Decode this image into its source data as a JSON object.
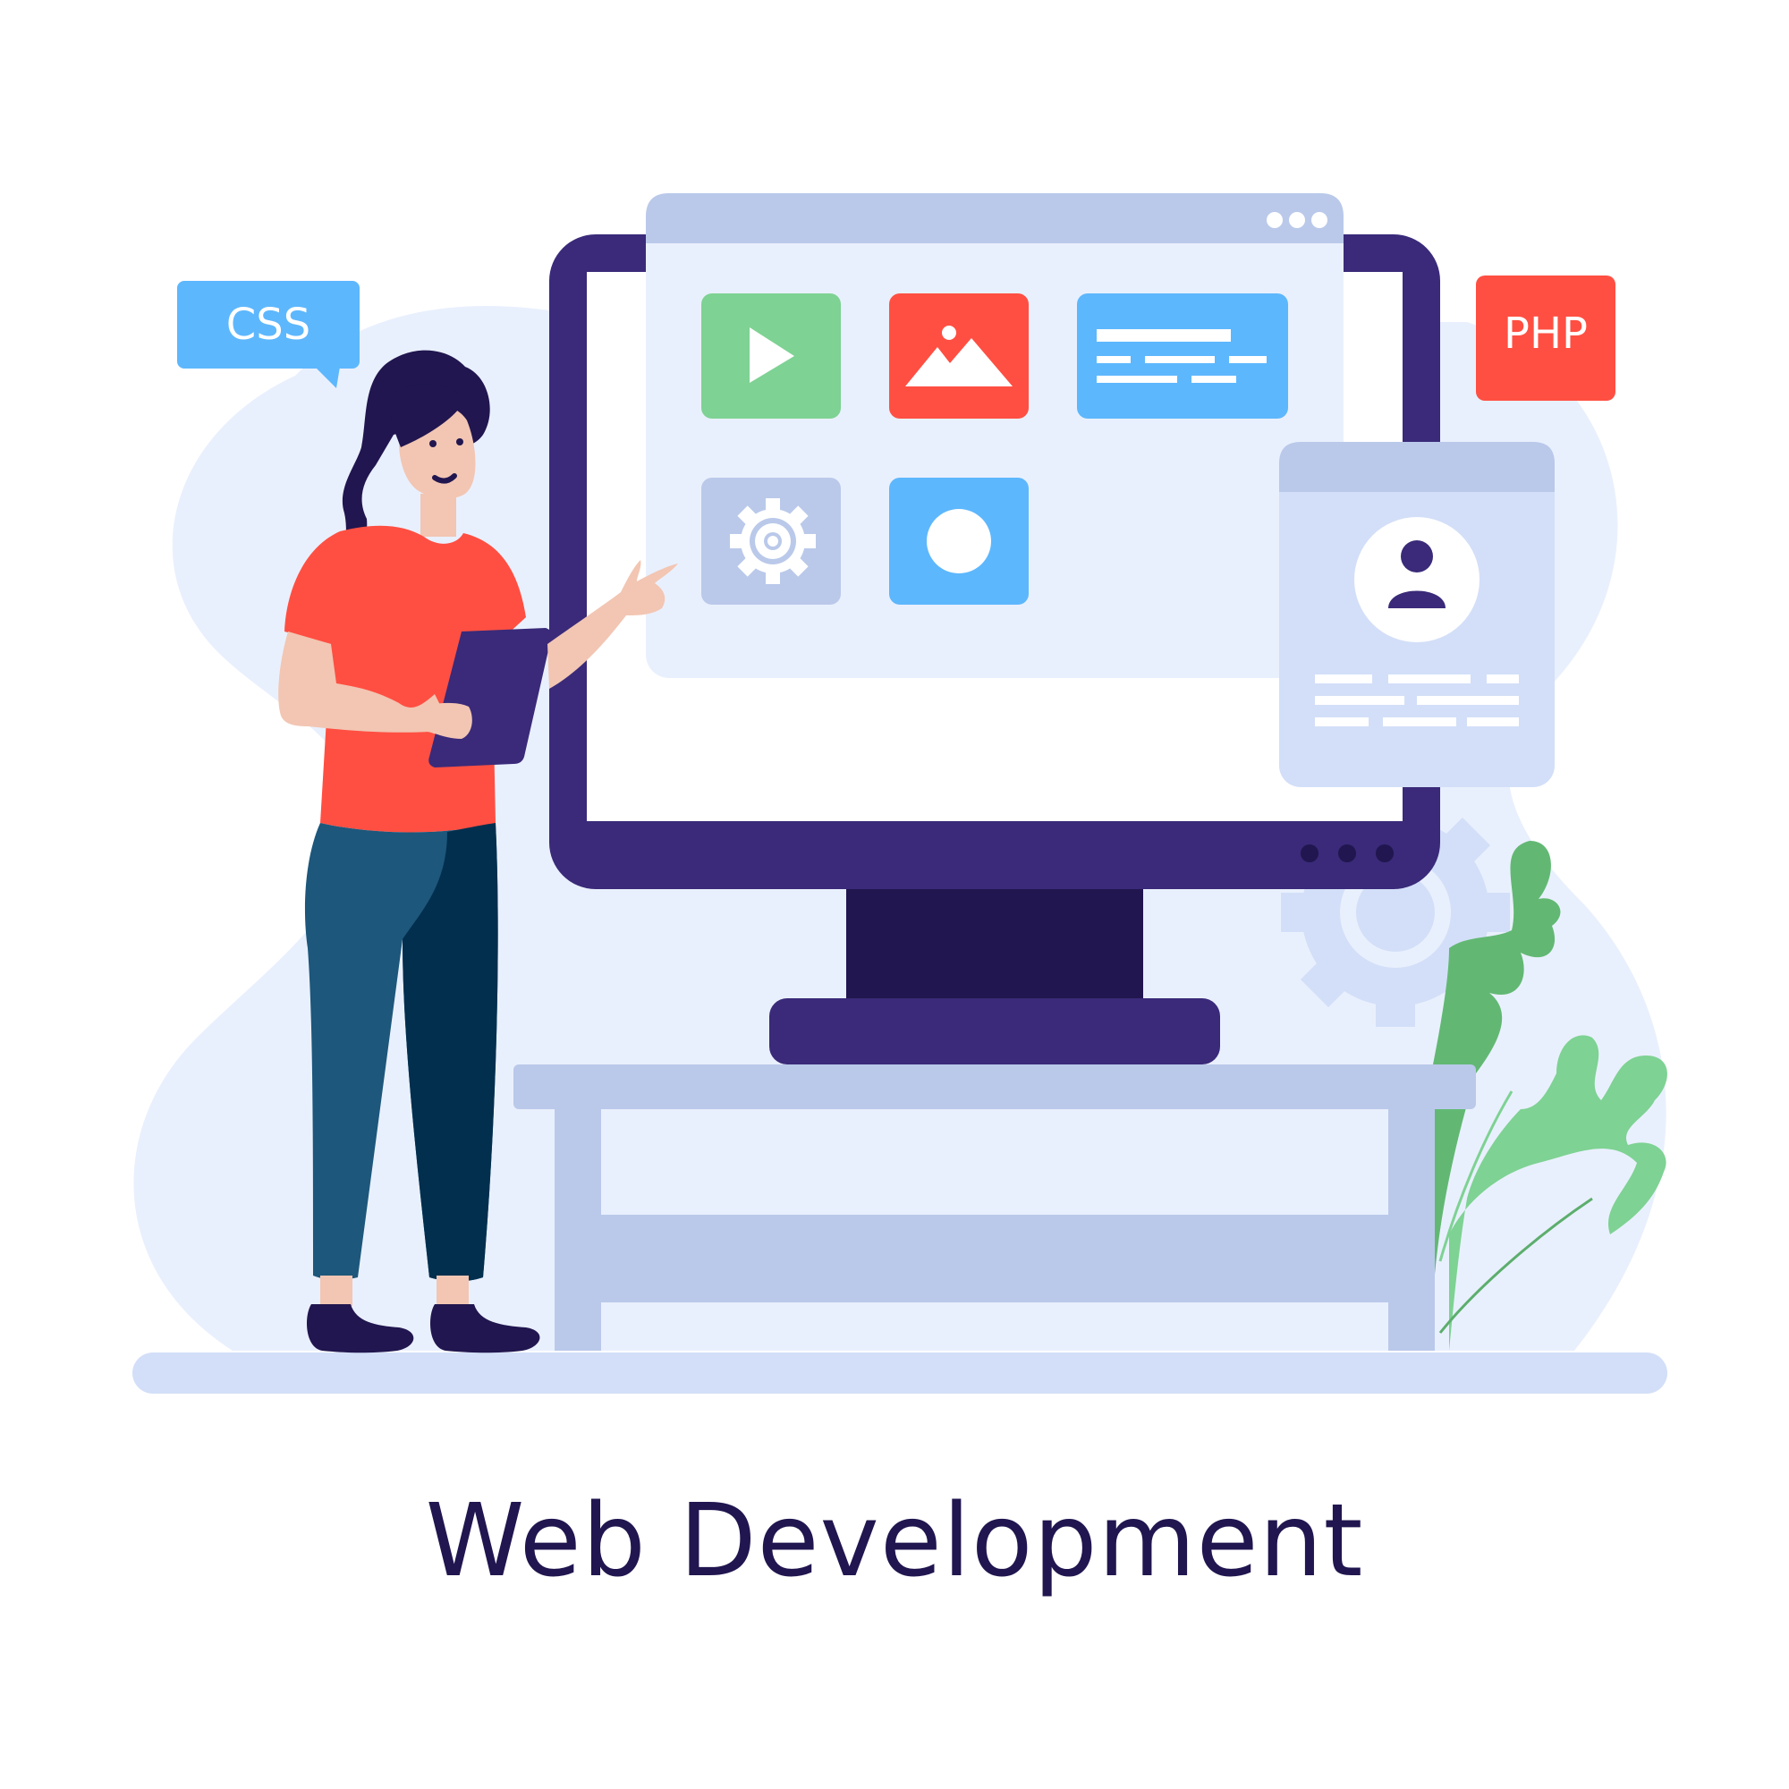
{
  "badges": {
    "css": "CSS",
    "php": "PHP"
  },
  "caption": "Web Development",
  "colors": {
    "navy": "#3a2a79",
    "dark_navy": "#21164f",
    "blob": "#e9f0fd",
    "panel": "#bac9ea",
    "panel_light": "#d3dff8",
    "green": "#7ed293",
    "red": "#ff4f42",
    "blue": "#5db7fd",
    "shirt": "#ff4f42",
    "skin": "#f2c6b3",
    "pants_light": "#1d577b",
    "pants_dark": "#022f4e"
  },
  "icons": [
    "play-icon",
    "image-icon",
    "text-lines-icon",
    "gear-icon",
    "record-icon",
    "user-avatar-icon"
  ]
}
